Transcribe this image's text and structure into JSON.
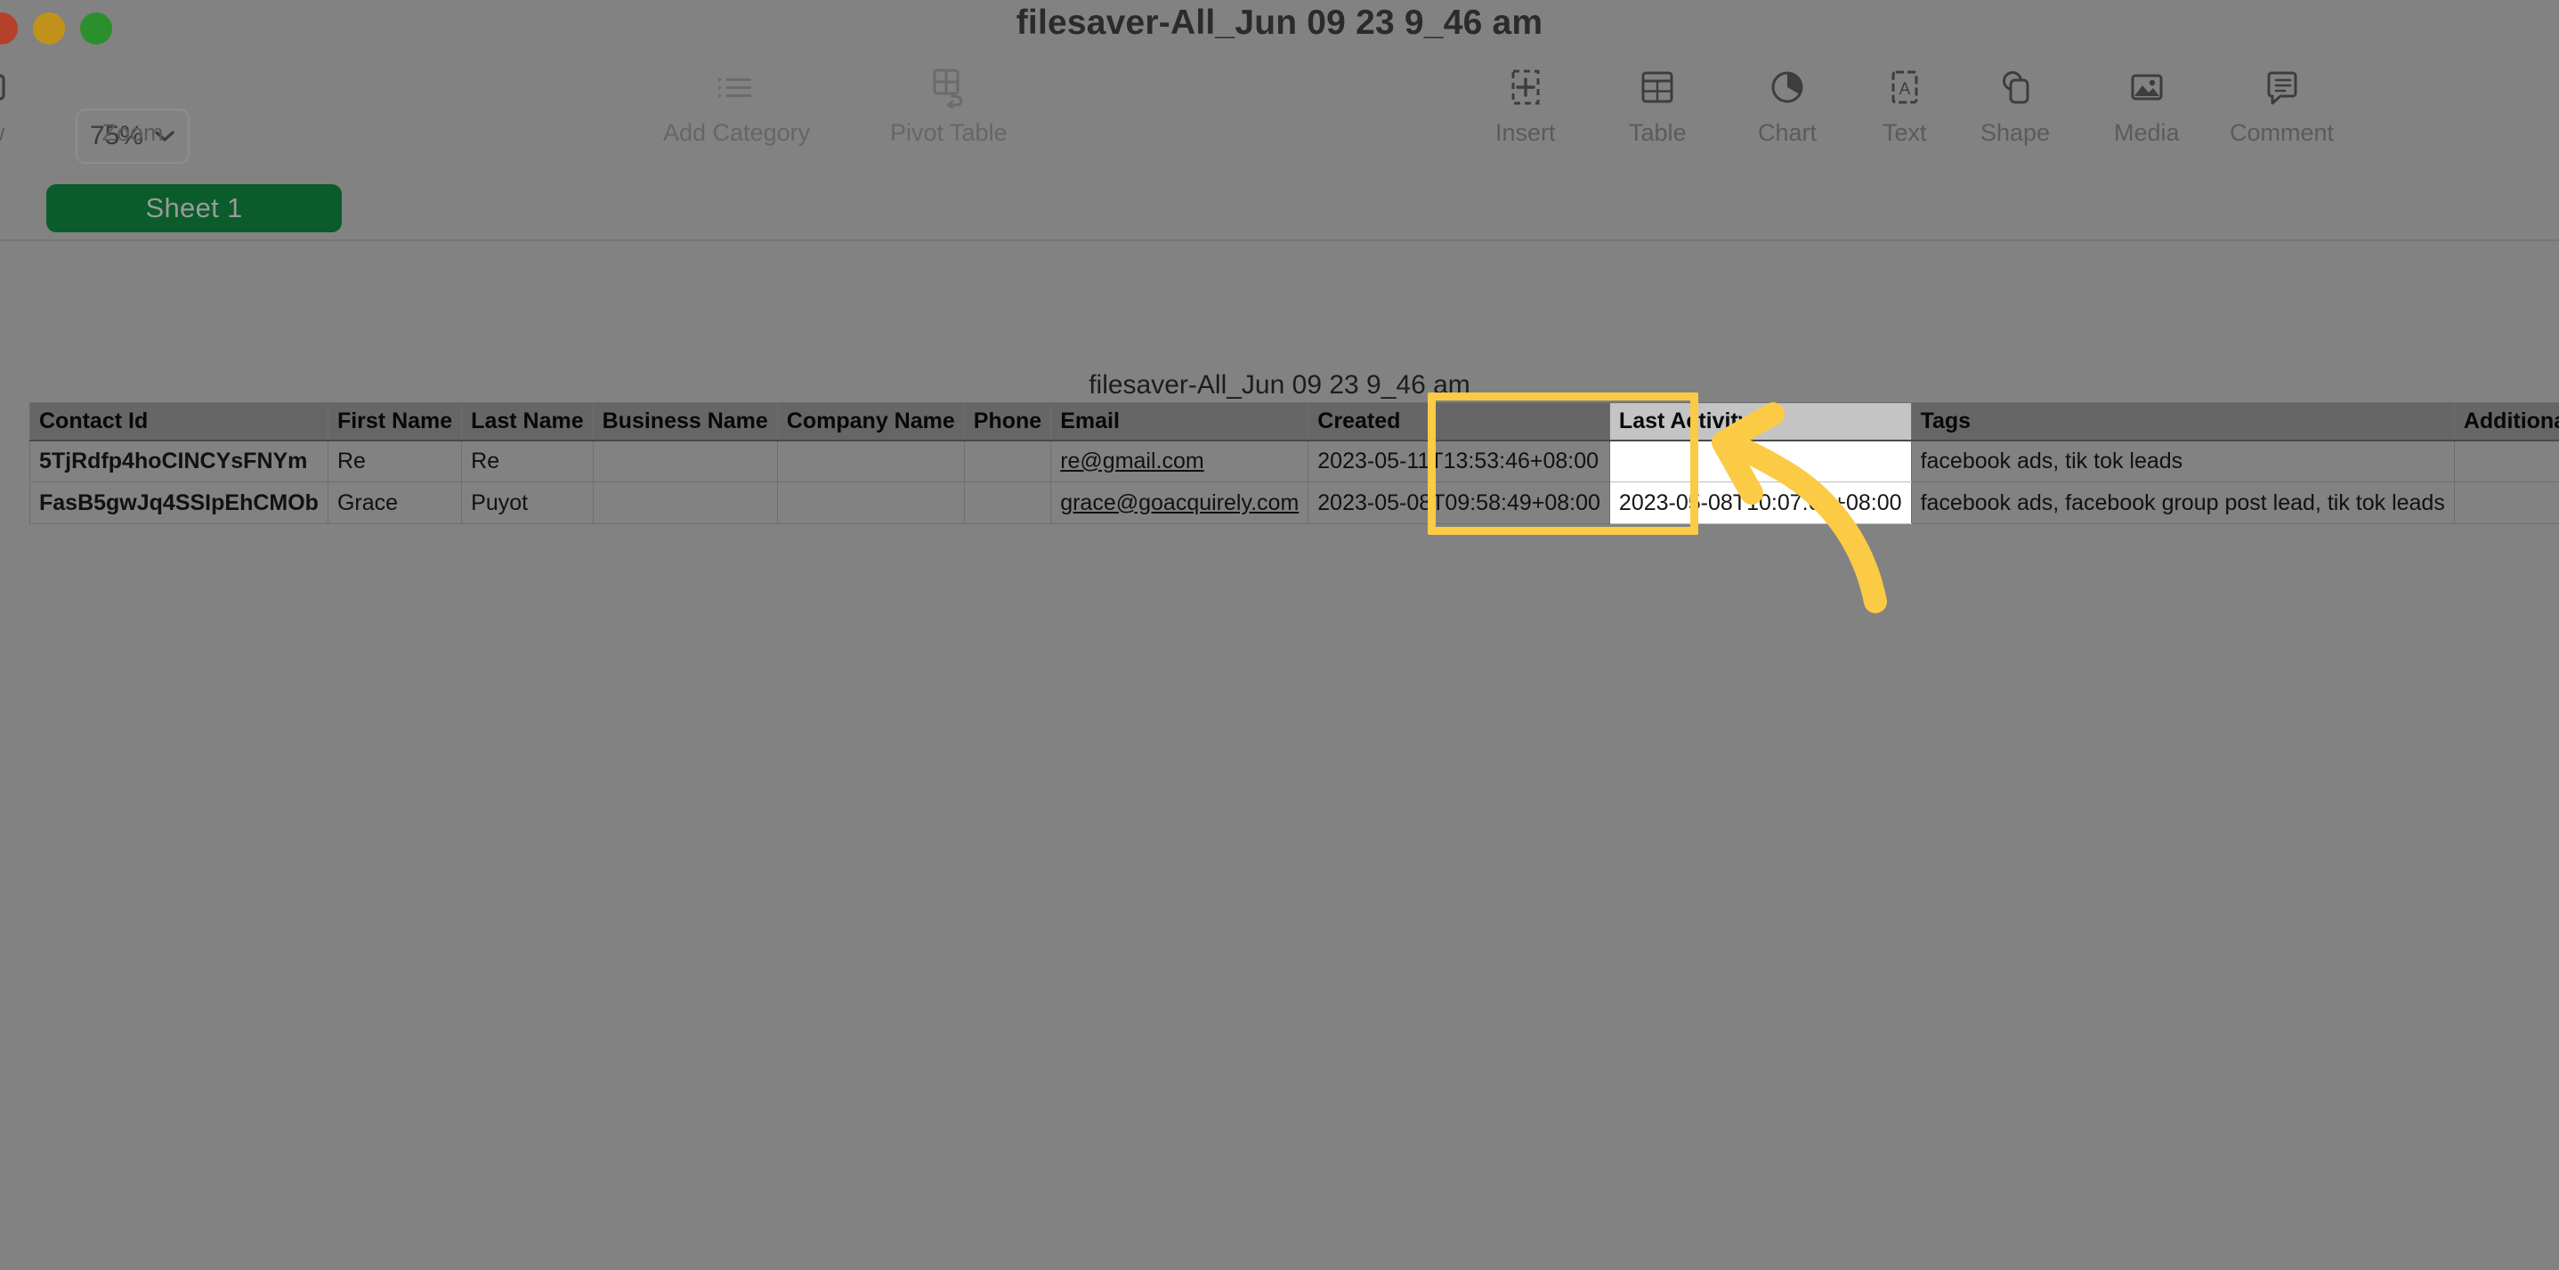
{
  "window": {
    "title": "filesaver-All_Jun 09 23 9_46 am",
    "traffic_lights": [
      "close-red",
      "minimize-yellow",
      "zoom-green"
    ]
  },
  "toolbar": {
    "left_group": [
      {
        "label": "ew",
        "icon": "view-panel-icon",
        "full_label": "View",
        "dimmed": false
      }
    ],
    "zoom": {
      "label": "Zoom",
      "value": "75%",
      "icon": "chevron-down-icon"
    },
    "middle_group": [
      {
        "label": "Add Category",
        "icon": "bulleted-list-icon",
        "dimmed": true
      },
      {
        "label": "Pivot Table",
        "icon": "pivot-table-icon",
        "dimmed": true
      }
    ],
    "right_group": [
      {
        "label": "Insert",
        "icon": "insert-cell-icon"
      },
      {
        "label": "Table",
        "icon": "table-grid-icon"
      },
      {
        "label": "Chart",
        "icon": "pie-chart-icon"
      },
      {
        "label": "Text",
        "icon": "text-box-icon"
      },
      {
        "label": "Shape",
        "icon": "shapes-icon"
      },
      {
        "label": "Media",
        "icon": "media-photo-icon"
      },
      {
        "label": "Comment",
        "icon": "comment-bubble-icon"
      }
    ]
  },
  "sheet_bar": {
    "tabs": [
      {
        "label": "Sheet 1",
        "active": true
      }
    ]
  },
  "canvas": {
    "document_caption": "filesaver-All_Jun 09 23 9_46 am"
  },
  "table": {
    "headers": [
      "Contact Id",
      "First Name",
      "Last Name",
      "Business Name",
      "Company Name",
      "Phone",
      "Email",
      "Created",
      "Last Activity",
      "Tags",
      "Additional Emails",
      ""
    ],
    "highlighted_column": "Last Activity",
    "rows": [
      {
        "contact_id": "5TjRdfp4hoCINCYsFNYm",
        "first_name": "Re",
        "last_name": "Re",
        "business_name": "",
        "company_name": "",
        "phone": "",
        "email": "re@gmail.com",
        "created": "2023-05-11T13:53:46+08:00",
        "last_activity": "",
        "tags": "facebook ads, tik tok leads",
        "additional_emails": "",
        "extra": ""
      },
      {
        "contact_id": "FasB5gwJq4SSIpEhCMOb",
        "first_name": "Grace",
        "last_name": "Puyot",
        "business_name": "",
        "company_name": "",
        "phone": "",
        "email": "grace@goacquirely.com",
        "created": "2023-05-08T09:58:49+08:00",
        "last_activity": "2023-05-08T10:07:08+08:00",
        "tags": "facebook ads, facebook group post lead, tik tok leads",
        "additional_emails": "",
        "extra": ""
      }
    ]
  },
  "annotations": {
    "highlight_color": "#fbcb46",
    "arrow": {
      "name": "pointer-arrow",
      "color": "#fbcb46",
      "direction": "up-left"
    }
  },
  "colors": {
    "background": "#828282",
    "header_row": "#666666",
    "sheet_tab_active": "#0a5c2b",
    "highlight": "#fbcb46"
  }
}
